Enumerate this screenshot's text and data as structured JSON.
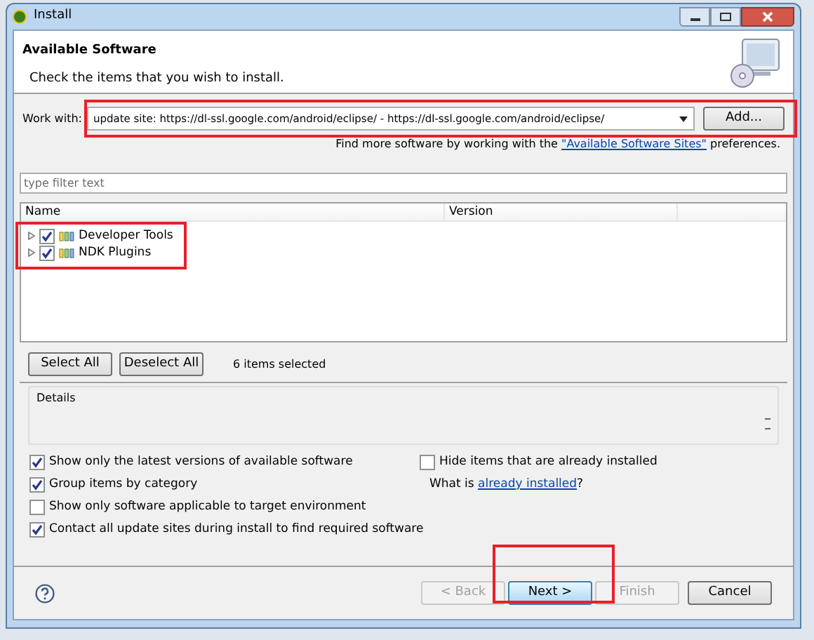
{
  "window": {
    "title": "Install"
  },
  "header": {
    "title": "Available Software",
    "description": "Check the items that you wish to install."
  },
  "work_with": {
    "label": "Work with:",
    "value": "update site: https://dl-ssl.google.com/android/eclipse/ - https://dl-ssl.google.com/android/eclipse/",
    "add_button": "Add..."
  },
  "more_software": {
    "prefix": "Find more software by working with the ",
    "link": "\"Available Software Sites\"",
    "suffix": " preferences."
  },
  "filter": {
    "placeholder": "type filter text"
  },
  "tree": {
    "columns": [
      "Name",
      "Version"
    ],
    "items": [
      {
        "label": "Developer Tools",
        "checked": true,
        "expanded": false
      },
      {
        "label": "NDK Plugins",
        "checked": true,
        "expanded": false
      }
    ]
  },
  "selection_buttons": [
    "Select All",
    "Deselect All"
  ],
  "selection_count": "6 items selected",
  "details": {
    "label": "Details"
  },
  "options": [
    {
      "label": "Show only the latest versions of available software",
      "checked": true
    },
    {
      "label": "Group items by category",
      "checked": true
    },
    {
      "label": "Show only software applicable to target environment",
      "checked": false
    },
    {
      "label": "Contact all update sites during install to find required software",
      "checked": true
    }
  ],
  "hide_installed": {
    "label": "Hide items that are already installed",
    "checked": false
  },
  "what_is": {
    "prefix": "What is ",
    "link": "already installed",
    "suffix": "?"
  },
  "footer_buttons": [
    {
      "label": "< Back",
      "disabled": true,
      "default": false
    },
    {
      "label": "Next >",
      "disabled": false,
      "default": true
    },
    {
      "label": "Finish",
      "disabled": true,
      "default": false
    },
    {
      "label": "Cancel",
      "disabled": false,
      "default": false
    }
  ]
}
